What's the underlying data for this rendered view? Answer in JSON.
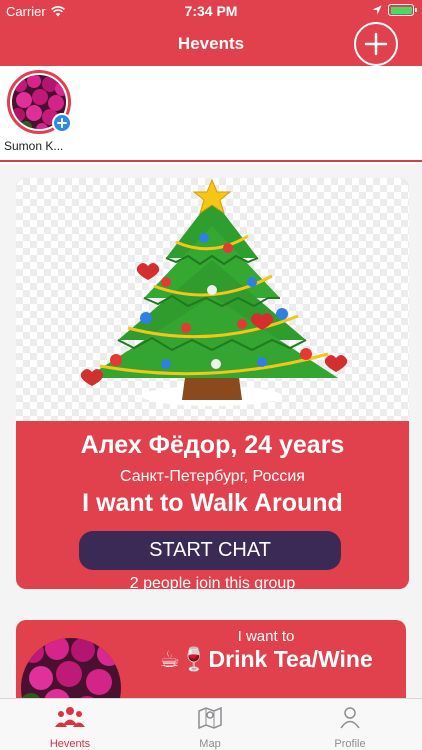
{
  "status_bar": {
    "carrier": "Carrier",
    "time": "7:34 PM",
    "battery_icon": "battery-full-icon"
  },
  "nav": {
    "title": "Hevents",
    "add_icon": "plus-circle-icon"
  },
  "stories": [
    {
      "name": "Sumon K..."
    }
  ],
  "event_card": {
    "name": "Алех Фёдор, 24 years",
    "location": "Санкт-Петербург, Россия",
    "want": "I want to Walk Around",
    "chat_button": "START CHAT",
    "join_text": "2 people join this group"
  },
  "event_card_2": {
    "intro": "I want to",
    "activity": "Drink Tea/Wine",
    "activity_icons": "☕🍷"
  },
  "tabs": [
    {
      "label": "Hevents",
      "icon": "people-icon",
      "active": true
    },
    {
      "label": "Map",
      "icon": "map-pin-icon",
      "active": false
    },
    {
      "label": "Profile",
      "icon": "person-icon",
      "active": false
    }
  ],
  "colors": {
    "accent": "#e0414c",
    "button": "#3a2a55",
    "active_tab": "#d9343f",
    "inactive_tab": "#8e8e93"
  }
}
